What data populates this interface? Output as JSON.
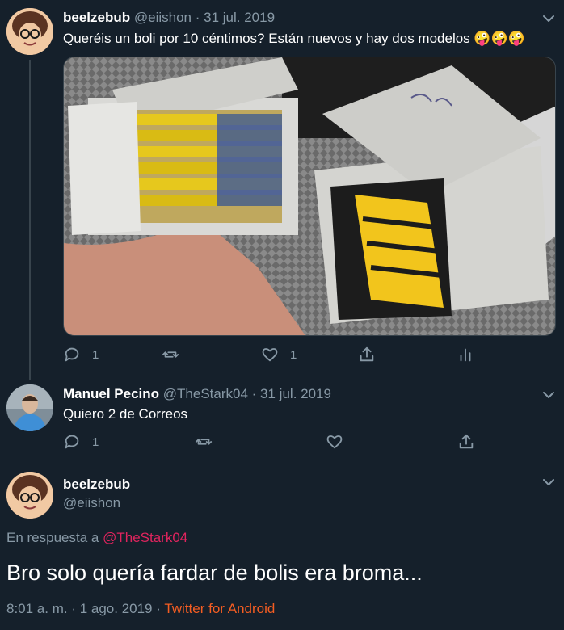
{
  "tweets": [
    {
      "name": "beelzebub",
      "handle": "@eiishon",
      "separator": "·",
      "date": "31 jul. 2019",
      "text": "Queréis un boli por 10 céntimos? Están nuevos y hay dos modelos 🤪🤪🤪",
      "actions": {
        "reply_count": "1",
        "retweet_count": "",
        "like_count": "1"
      }
    },
    {
      "name": "Manuel Pecino",
      "handle": "@TheStark04",
      "separator": "·",
      "date": "31 jul. 2019",
      "text": "Quiero 2 de Correos",
      "actions": {
        "reply_count": "1",
        "retweet_count": "",
        "like_count": ""
      }
    }
  ],
  "main_tweet": {
    "name": "beelzebub",
    "handle": "@eiishon",
    "reply_prefix": "En respuesta a",
    "reply_target": "@TheStark04",
    "text": "Bro solo quería fardar de bolis era broma...",
    "timestamp": "8:01 a. m. · 1 ago. 2019 ·",
    "source": "Twitter for Android"
  },
  "colors": {
    "background": "#15202b",
    "muted": "#8899a6",
    "link_pink": "#e0245e",
    "link_orange": "#f45d22"
  }
}
